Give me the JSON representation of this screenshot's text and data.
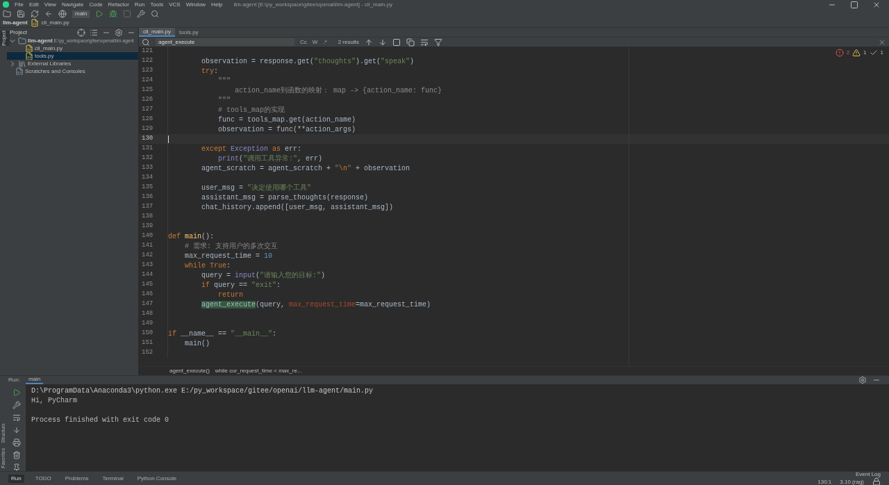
{
  "title_bar": {
    "menu": [
      "File",
      "Edit",
      "View",
      "Navigate",
      "Code",
      "Refactor",
      "Run",
      "Tools",
      "VCS",
      "Window",
      "Help"
    ],
    "title": "llm-agent [E:\\py_workspace\\gitee\\openai\\llm-agent] - cli_main.py"
  },
  "toolbar": {
    "run_config": "main"
  },
  "nav_bar": {
    "project": "llm-agent",
    "file": "cli_main.py"
  },
  "side_stripe": {
    "top": "Project",
    "bottom": [
      "Structure",
      "Favorites"
    ]
  },
  "project_panel": {
    "title": "Project",
    "tree": [
      {
        "label": "llm-agent",
        "path": "E:\\py_workspace\\gitee\\openai\\llm-agent",
        "kind": "folder",
        "expanded": true,
        "selected": false,
        "children": [
          {
            "label": "cli_main.py",
            "kind": "python",
            "selected": false
          },
          {
            "label": "tools.py",
            "kind": "python",
            "selected": true
          }
        ]
      },
      {
        "label": "External Libraries",
        "kind": "library",
        "expanded": false,
        "selected": false
      },
      {
        "label": "Scratches and Consoles",
        "kind": "scratch",
        "selected": false
      }
    ]
  },
  "editor": {
    "tabs": [
      {
        "label": "cli_main.py",
        "selected": true
      },
      {
        "label": "tools.py",
        "selected": false
      }
    ],
    "find": {
      "query": "agent_execute",
      "options": [
        "Cc",
        "W",
        ".*"
      ],
      "results": "2 results"
    },
    "inspections": {
      "errors": "2",
      "warnings": "1",
      "weak": "1"
    },
    "lines": [
      {
        "n": "121",
        "current": false
      },
      {
        "n": "122",
        "current": false,
        "tokens": [
          {
            "kind": "plain",
            "t": "        observation = response.get("
          },
          {
            "kind": "str",
            "t": "\"thoughts\""
          },
          {
            "kind": "plain",
            "t": ").get("
          },
          {
            "kind": "str",
            "t": "\"speak\""
          },
          {
            "kind": "plain",
            "t": ")"
          }
        ]
      },
      {
        "n": "123",
        "current": false,
        "tokens": [
          {
            "kind": "kw",
            "t": "        try"
          },
          {
            "kind": "plain",
            "t": ":"
          }
        ]
      },
      {
        "n": "124",
        "current": false,
        "tokens": [
          {
            "kind": "comment",
            "t": "            \"\"\""
          }
        ]
      },
      {
        "n": "125",
        "current": false,
        "tokens": [
          {
            "kind": "comment",
            "t": "                action_name到函数的映射： map -> {action_name: func}"
          }
        ]
      },
      {
        "n": "126",
        "current": false,
        "tokens": [
          {
            "kind": "comment",
            "t": "            \"\"\""
          }
        ]
      },
      {
        "n": "127",
        "current": false,
        "tokens": [
          {
            "kind": "comment",
            "t": "            # tools_map的实现"
          }
        ]
      },
      {
        "n": "128",
        "current": false,
        "tokens": [
          {
            "kind": "plain",
            "t": "            func = tools_map.get(action_name)"
          }
        ]
      },
      {
        "n": "129",
        "current": false,
        "tokens": [
          {
            "kind": "plain",
            "t": "            observation = func(**action_args)"
          }
        ]
      },
      {
        "n": "130",
        "current": true
      },
      {
        "n": "131",
        "current": false,
        "tokens": [
          {
            "kind": "kw",
            "t": "        except "
          },
          {
            "kind": "builtin",
            "t": "Exception "
          },
          {
            "kind": "kw",
            "t": "as "
          },
          {
            "kind": "plain",
            "t": "err:"
          }
        ]
      },
      {
        "n": "132",
        "current": false,
        "tokens": [
          {
            "kind": "builtin",
            "t": "            print"
          },
          {
            "kind": "plain",
            "t": "("
          },
          {
            "kind": "str",
            "t": "\"调用工具异常:\""
          },
          {
            "kind": "plain",
            "t": ", err)"
          }
        ]
      },
      {
        "n": "133",
        "current": false,
        "tokens": [
          {
            "kind": "plain",
            "t": "        agent_scratch = agent_scratch + "
          },
          {
            "kind": "str",
            "t": "\""
          },
          {
            "kind": "kw",
            "t": "\\n"
          },
          {
            "kind": "str",
            "t": "\""
          },
          {
            "kind": "plain",
            "t": " + observation"
          }
        ]
      },
      {
        "n": "134",
        "current": false
      },
      {
        "n": "135",
        "current": false,
        "tokens": [
          {
            "kind": "plain",
            "t": "        user_msg = "
          },
          {
            "kind": "str",
            "t": "\"决定使用哪个工具\""
          }
        ]
      },
      {
        "n": "136",
        "current": false,
        "tokens": [
          {
            "kind": "plain",
            "t": "        assistant_msg = parse_thoughts(response)"
          }
        ]
      },
      {
        "n": "137",
        "current": false,
        "tokens": [
          {
            "kind": "plain",
            "t": "        chat_history.append([user_msg, assistant_msg])"
          }
        ]
      },
      {
        "n": "138",
        "current": false
      },
      {
        "n": "139",
        "current": false
      },
      {
        "n": "140",
        "current": false,
        "tokens": [
          {
            "kind": "kw",
            "t": "def "
          },
          {
            "kind": "fn",
            "t": "main"
          },
          {
            "kind": "plain",
            "t": "():"
          }
        ]
      },
      {
        "n": "141",
        "current": false,
        "tokens": [
          {
            "kind": "comment",
            "t": "    # 需求: 支持用户的多次交互"
          }
        ]
      },
      {
        "n": "142",
        "current": false,
        "tokens": [
          {
            "kind": "plain",
            "t": "    max_request_time = "
          },
          {
            "kind": "num",
            "t": "10"
          }
        ]
      },
      {
        "n": "143",
        "current": false,
        "tokens": [
          {
            "kind": "kw",
            "t": "    while True"
          },
          {
            "kind": "plain",
            "t": ":"
          }
        ]
      },
      {
        "n": "144",
        "current": false,
        "tokens": [
          {
            "kind": "plain",
            "t": "        query = "
          },
          {
            "kind": "builtin",
            "t": "input"
          },
          {
            "kind": "plain",
            "t": "("
          },
          {
            "kind": "str",
            "t": "\"请输入您的目标:\""
          },
          {
            "kind": "plain",
            "t": ")"
          }
        ]
      },
      {
        "n": "145",
        "current": false,
        "tokens": [
          {
            "kind": "kw",
            "t": "        if "
          },
          {
            "kind": "plain",
            "t": "query == "
          },
          {
            "kind": "str",
            "t": "\"exit\""
          },
          {
            "kind": "plain",
            "t": ":"
          }
        ]
      },
      {
        "n": "146",
        "current": false,
        "tokens": [
          {
            "kind": "kw",
            "t": "            return"
          }
        ]
      },
      {
        "n": "147",
        "current": false,
        "tokens": [
          {
            "kind": "match",
            "t": "        agent_execute"
          },
          {
            "kind": "plain",
            "t": "(query, "
          },
          {
            "kind": "param",
            "t": "max_request_time"
          },
          {
            "kind": "plain",
            "t": "=max_request_time)"
          }
        ]
      },
      {
        "n": "148",
        "current": false
      },
      {
        "n": "149",
        "current": false
      },
      {
        "n": "150",
        "current": false,
        "tokens": [
          {
            "kind": "kw",
            "t": "if "
          },
          {
            "kind": "plain",
            "t": "__name__ == "
          },
          {
            "kind": "str",
            "t": "\"__main__\""
          },
          {
            "kind": "plain",
            "t": ":"
          }
        ]
      },
      {
        "n": "151",
        "current": false,
        "tokens": [
          {
            "kind": "plain",
            "t": "    main()"
          }
        ]
      },
      {
        "n": "152",
        "current": false
      }
    ],
    "breadcrumbs": [
      "agent_execute()",
      "while cur_request_time < max_re..."
    ]
  },
  "run_panel": {
    "label": "Run:",
    "tab": "main",
    "output": [
      {
        "kind": "command",
        "text": "D:\\ProgramData\\Anaconda3\\python.exe E:/py_workspace/gitee/openai/llm-agent/main.py"
      },
      {
        "kind": "stdout",
        "text": "Hi, PyCharm"
      },
      {
        "kind": "exit",
        "text": "Process finished with exit code 0"
      }
    ]
  },
  "tool_tabs": [
    {
      "label": "Run",
      "selected": true
    },
    {
      "label": "TODO",
      "selected": false
    },
    {
      "label": "Problems",
      "selected": false
    },
    {
      "label": "Terminal",
      "selected": false
    },
    {
      "label": "Python Console",
      "selected": false
    }
  ],
  "status_bar": {
    "event_log": "Event Log",
    "position": "130:1",
    "interpreter": "3.10 (rag)"
  }
}
